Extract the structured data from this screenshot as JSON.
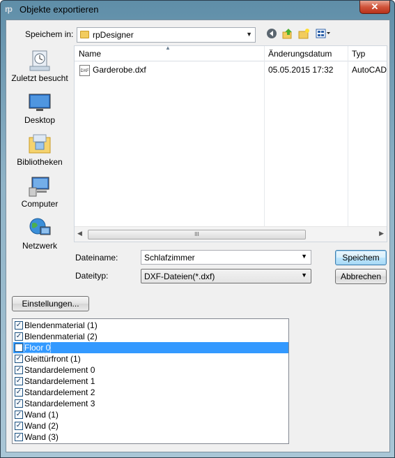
{
  "window": {
    "title": "Objekte exportieren",
    "app_icon_text": "rp",
    "close_glyph": "✕"
  },
  "toolbar": {
    "save_in_label": "Speichem in:",
    "location": "rpDesigner",
    "icons": [
      "back-icon",
      "up-folder-icon",
      "new-folder-icon",
      "view-menu-icon"
    ]
  },
  "places": [
    {
      "label": "Zuletzt besucht",
      "icon": "recent-places-icon"
    },
    {
      "label": "Desktop",
      "icon": "desktop-icon"
    },
    {
      "label": "Bibliotheken",
      "icon": "libraries-icon"
    },
    {
      "label": "Computer",
      "icon": "computer-icon"
    },
    {
      "label": "Netzwerk",
      "icon": "network-icon"
    }
  ],
  "filelist": {
    "columns": [
      "Name",
      "Änderungsdatum",
      "Typ"
    ],
    "rows": [
      {
        "name": "Garderobe.dxf",
        "date": "05.05.2015 17:32",
        "type": "AutoCAD"
      }
    ],
    "scroll_grip": "III"
  },
  "form": {
    "filename_label": "Dateiname:",
    "filename_value": "Schlafzimmer",
    "filetype_label": "Dateityp:",
    "filetype_value": "DXF-Dateien(*.dxf)",
    "save_button": "Speichem",
    "cancel_button": "Abbrechen",
    "settings_button": "Einstellungen..."
  },
  "objects": [
    {
      "label": "Blendenmaterial (1)",
      "checked": true
    },
    {
      "label": "Blendenmaterial (2)",
      "checked": true
    },
    {
      "label": "Floor 0",
      "checked": false,
      "selected": true
    },
    {
      "label": "Gleittürfront (1)",
      "checked": true
    },
    {
      "label": "Standardelement 0",
      "checked": true
    },
    {
      "label": "Standardelement 1",
      "checked": true
    },
    {
      "label": "Standardelement 2",
      "checked": true
    },
    {
      "label": "Standardelement 3",
      "checked": true
    },
    {
      "label": "Wand (1)",
      "checked": true
    },
    {
      "label": "Wand (2)",
      "checked": true
    },
    {
      "label": "Wand (3)",
      "checked": true
    }
  ],
  "colors": {
    "selection": "#3399ff",
    "titlebar": "#6b98b4",
    "close": "#c8452c"
  }
}
